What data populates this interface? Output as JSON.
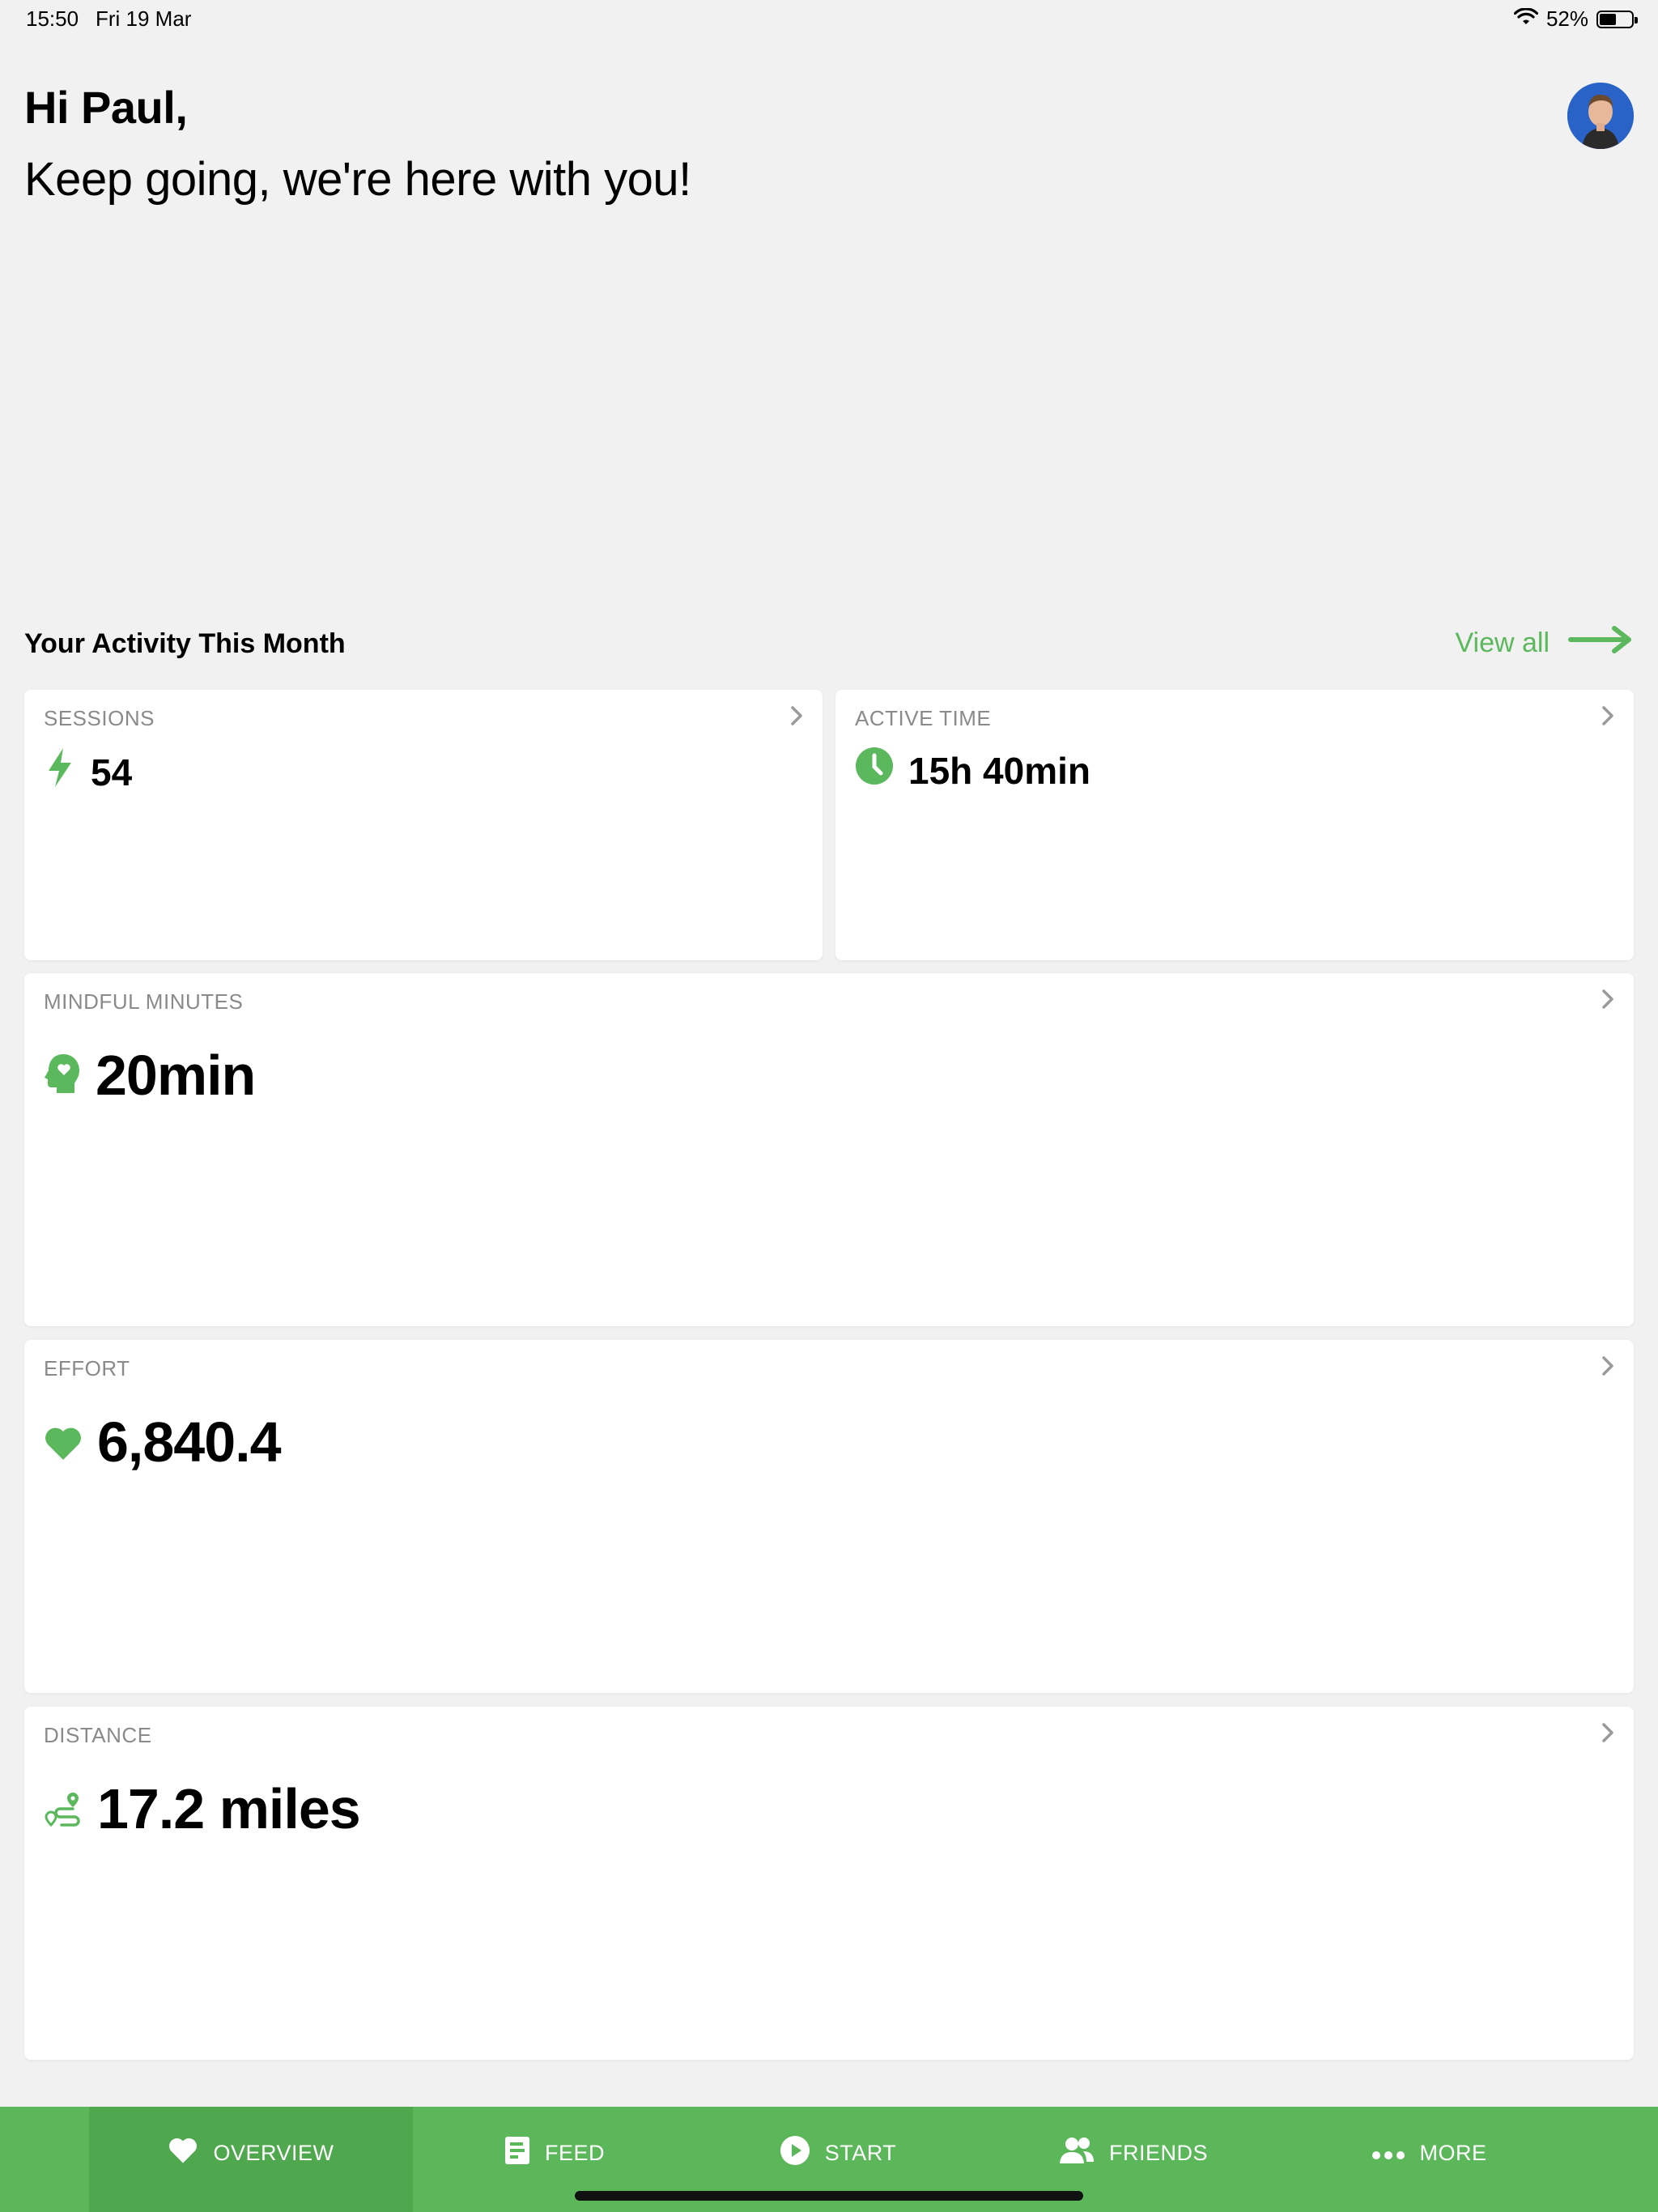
{
  "status_bar": {
    "time": "15:50",
    "date": "Fri 19 Mar",
    "battery_percent": "52%",
    "battery_level": 0.52
  },
  "header": {
    "greeting": "Hi Paul,",
    "subtitle": "Keep going, we're here with you!",
    "avatar_icon": "user-avatar"
  },
  "activity": {
    "title": "Your Activity This Month",
    "view_all_label": "View all",
    "cards": {
      "sessions": {
        "label": "SESSIONS",
        "value": "54",
        "icon": "lightning-icon"
      },
      "active_time": {
        "label": "ACTIVE TIME",
        "value": "15h 40min",
        "icon": "clock-icon"
      },
      "mindful": {
        "label": "MINDFUL MINUTES",
        "value": "20min",
        "icon": "mind-icon"
      },
      "effort": {
        "label": "EFFORT",
        "value": "6,840.4",
        "icon": "heart-icon"
      },
      "distance": {
        "label": "DISTANCE",
        "value": "17.2 miles",
        "icon": "route-icon"
      }
    }
  },
  "tabs": [
    {
      "label": "OVERVIEW",
      "icon": "heart-icon",
      "active": true
    },
    {
      "label": "FEED",
      "icon": "feed-icon",
      "active": false
    },
    {
      "label": "START",
      "icon": "play-icon",
      "active": false
    },
    {
      "label": "FRIENDS",
      "icon": "friends-icon",
      "active": false
    },
    {
      "label": "MORE",
      "icon": "more-icon",
      "active": false
    }
  ],
  "colors": {
    "accent": "#5cb85c",
    "tabbar": "#5cb75a",
    "tab_active": "#4fa84e",
    "background": "#f1f1f1"
  }
}
